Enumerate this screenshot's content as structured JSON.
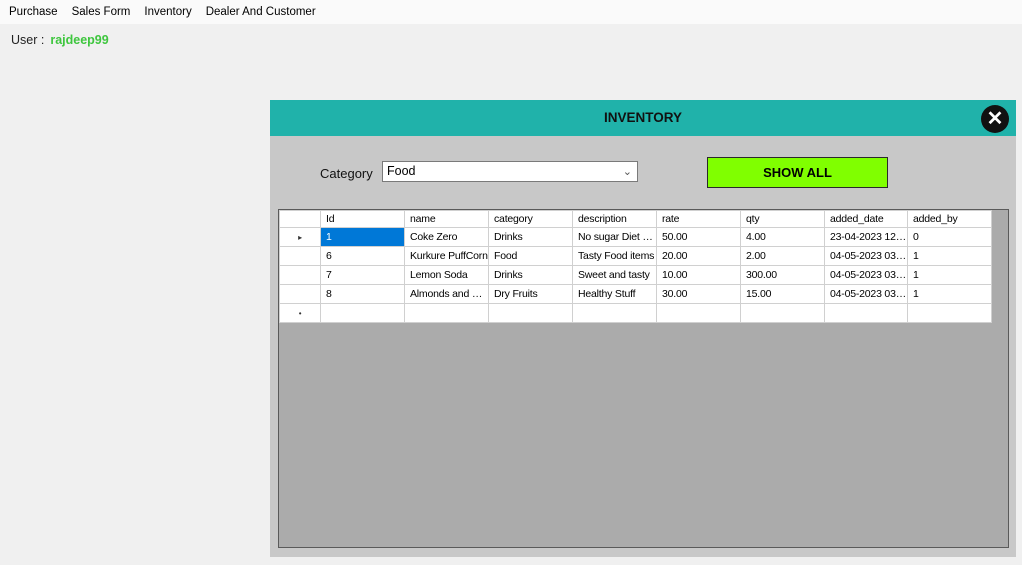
{
  "menu": [
    "Purchase",
    "Sales Form",
    "Inventory",
    "Dealer And Customer"
  ],
  "user": {
    "label": "User :",
    "name": "rajdeep99"
  },
  "panel": {
    "title": "INVENTORY",
    "close_icon": "close-icon",
    "category_label": "Category",
    "category_value": "Food",
    "show_all_label": "SHOW ALL",
    "colors": {
      "header": "#20b2aa",
      "button": "#80ff00",
      "selected": "#0078d7"
    }
  },
  "grid": {
    "columns": [
      "Id",
      "name",
      "category",
      "description",
      "rate",
      "qty",
      "added_date",
      "added_by"
    ],
    "rows": [
      [
        "1",
        "Coke Zero",
        "Drinks",
        "No sugar Diet Co...",
        "50.00",
        "4.00",
        "23-04-2023 12:3...",
        "0"
      ],
      [
        "6",
        "Kurkure PuffCorn",
        "Food",
        "Tasty Food items",
        "20.00",
        "2.00",
        "04-05-2023 03:5...",
        "1"
      ],
      [
        "7",
        "Lemon Soda",
        "Drinks",
        "Sweet and tasty",
        "10.00",
        "300.00",
        "04-05-2023 03:5...",
        "1"
      ],
      [
        "8",
        "Almonds and Cas...",
        "Dry Fruits",
        "Healthy Stuff",
        "30.00",
        "15.00",
        "04-05-2023 03:5...",
        "1"
      ]
    ],
    "current_row_marker": "▸",
    "new_row_marker": "•"
  }
}
